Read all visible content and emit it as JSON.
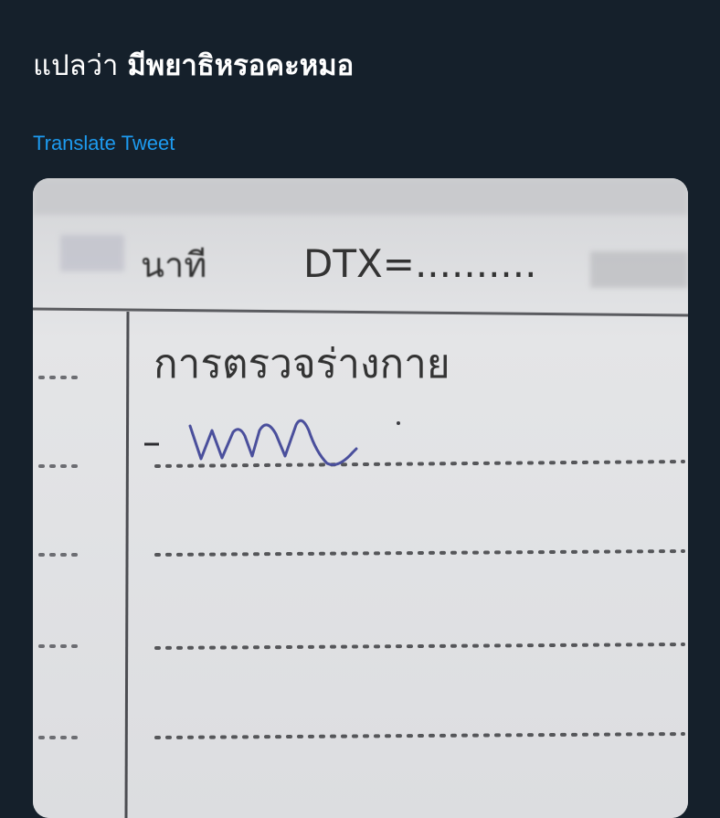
{
  "tweet": {
    "text_lead": "แปลว่า",
    "text_bold": "มีพยาธิหรอคะหมอ",
    "translate_label": "Translate Tweet"
  },
  "media": {
    "form_label_minute": "นาที",
    "form_label_dtx": "DTX=..........",
    "form_heading": "การตรวจร่างกาย"
  },
  "colors": {
    "background": "#15202b",
    "text": "#ffffff",
    "link": "#1d9bf0",
    "ink": "#4a4f9c"
  }
}
